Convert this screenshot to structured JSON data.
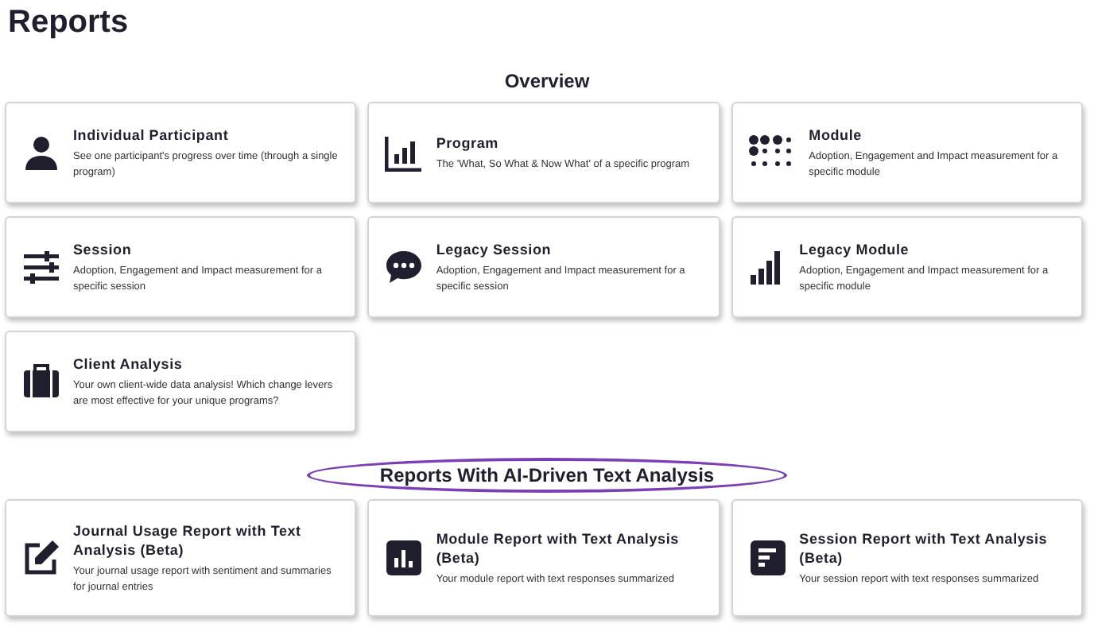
{
  "page_title": "Reports",
  "sections": [
    {
      "heading": "Overview",
      "highlighted": false,
      "cards": [
        {
          "kind": "person",
          "title": "Individual Participant",
          "description": "See one participant's progress over time (through a single program)"
        },
        {
          "kind": "chart",
          "title": "Program",
          "description": "The 'What, So What & Now What' of a specific program"
        },
        {
          "kind": "dots",
          "title": "Module",
          "description": "Adoption, Engagement and Impact measurement for a specific module"
        },
        {
          "kind": "sliders",
          "title": "Session",
          "description": "Adoption, Engagement and Impact measurement for a specific session"
        },
        {
          "kind": "chat",
          "title": "Legacy Session",
          "description": "Adoption, Engagement and Impact measurement for a specific session"
        },
        {
          "kind": "signal",
          "title": "Legacy Module",
          "description": "Adoption, Engagement and Impact measurement for a specific module"
        },
        {
          "kind": "briefcase",
          "title": "Client Analysis",
          "description": "Your own client-wide data analysis! Which change levers are most effective for your unique programs?"
        }
      ]
    },
    {
      "heading": "Reports With AI-Driven Text Analysis",
      "highlighted": true,
      "cards": [
        {
          "kind": "edit",
          "title": "Journal Usage Report with Text Analysis (Beta)",
          "description": "Your journal usage report with sentiment and summaries for journal entries"
        },
        {
          "kind": "chart-square",
          "title": "Module Report with Text Analysis (Beta)",
          "description": "Your module report with text responses summarized"
        },
        {
          "kind": "bars-square",
          "title": "Session Report with Text Analysis (Beta)",
          "description": "Your session report with text responses summarized"
        }
      ]
    }
  ]
}
